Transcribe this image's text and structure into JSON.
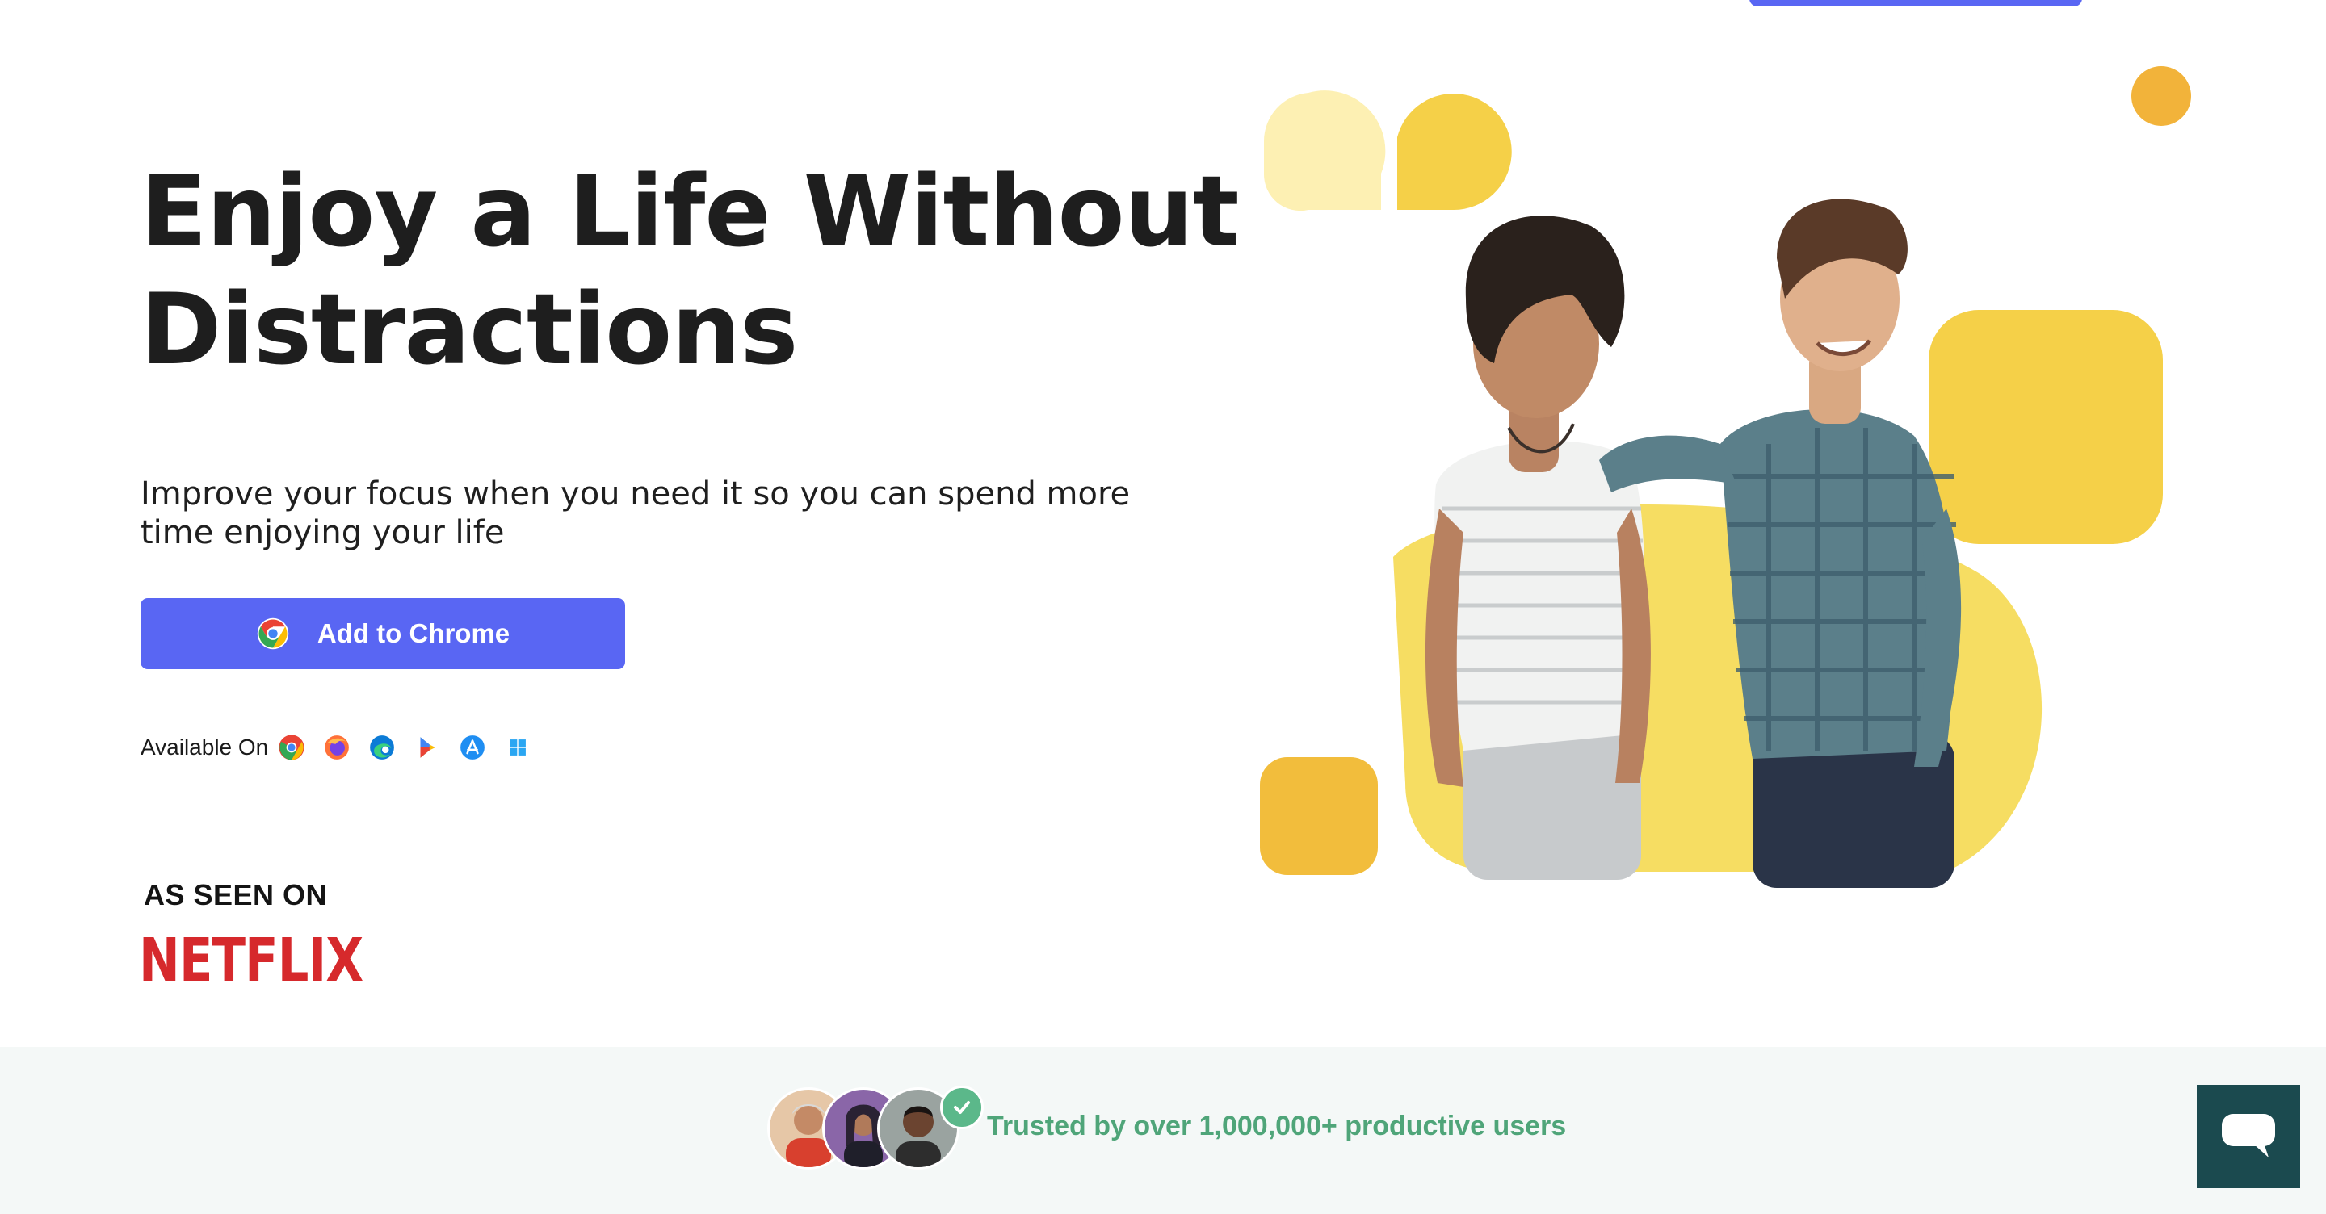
{
  "hero": {
    "title_line1": "Enjoy a Life Without",
    "title_line2": "Distractions",
    "subtitle": "Improve your focus when you need it so you can spend more time enjoying your life",
    "cta_label": "Add to Chrome",
    "available_label": "Available On",
    "platforms": [
      "chrome-icon",
      "firefox-icon",
      "edge-icon",
      "play-store-icon",
      "app-store-icon",
      "windows-icon"
    ]
  },
  "press": {
    "heading": "AS SEEN ON",
    "logo_text": "NETFLIX"
  },
  "trust": {
    "text": "Trusted by over 1,000,000+ productive users"
  },
  "colors": {
    "primary": "#5966f3",
    "yellow": "#f7d046",
    "netflix_red": "#d6292c",
    "trust_green": "#4fa579",
    "chat_bg": "#1b4a4f",
    "band_bg": "#f4f8f7"
  }
}
